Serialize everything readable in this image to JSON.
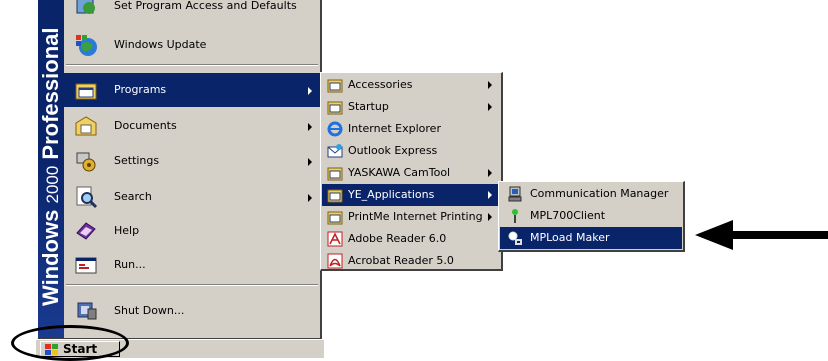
{
  "start_menu": {
    "sidebar": {
      "windows": "Windows",
      "year": "2000",
      "edition": "Professional"
    },
    "items": [
      {
        "label": "Set Program Access and Defaults",
        "icon": "program-access-icon"
      },
      {
        "label": "Windows Update",
        "icon": "windows-update-icon"
      },
      {
        "label": "Programs",
        "icon": "programs-folder-icon"
      },
      {
        "label": "Documents",
        "icon": "documents-folder-icon"
      },
      {
        "label": "Settings",
        "icon": "settings-icon"
      },
      {
        "label": "Search",
        "icon": "search-icon"
      },
      {
        "label": "Help",
        "icon": "help-icon"
      },
      {
        "label": "Run...",
        "icon": "run-icon"
      },
      {
        "label": "Shut Down...",
        "icon": "shutdown-icon"
      }
    ]
  },
  "taskbar": {
    "start_label": "Start"
  },
  "programs_menu": {
    "items": [
      {
        "label": "Accessories"
      },
      {
        "label": "Startup"
      },
      {
        "label": "Internet Explorer"
      },
      {
        "label": "Outlook Express"
      },
      {
        "label": "YASKAWA CamTool"
      },
      {
        "label": "YE_Applications"
      },
      {
        "label": "PrintMe Internet Printing"
      },
      {
        "label": "Adobe Reader 6.0"
      },
      {
        "label": "Acrobat Reader 5.0"
      }
    ]
  },
  "ye_applications_menu": {
    "items": [
      {
        "label": "Communication Manager"
      },
      {
        "label": "MPL700Client"
      },
      {
        "label": "MPLoad Maker"
      }
    ]
  },
  "colors": {
    "highlight": "#0a246a",
    "menu_bg": "#d4d0c8"
  }
}
